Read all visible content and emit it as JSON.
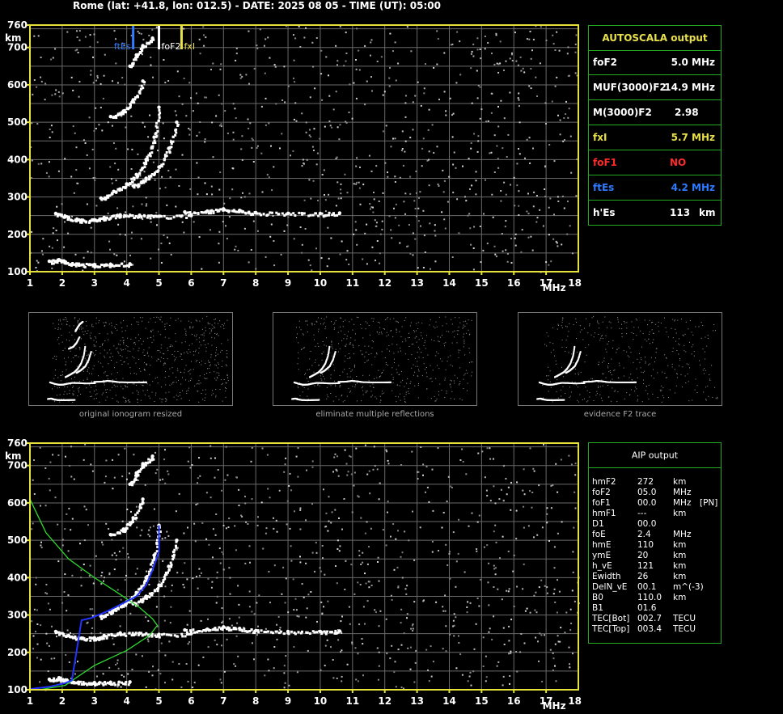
{
  "header": {
    "title": "Rome (lat: +41.8, lon: 012.5) - DATE: 2025 08 05 - TIME (UT): 05:00"
  },
  "colors": {
    "frame": "#e6e23a",
    "grid": "#6a6a6a",
    "table_border": "#1faa1f",
    "blue": "#2f7bff",
    "yellow": "#e8e04a",
    "red": "#ff2a2a",
    "green": "#2edc2e",
    "profile": "#2233ff"
  },
  "chart_data": [
    {
      "type": "scatter",
      "name": "top",
      "xlabel": "MHz",
      "ylabel": "km",
      "xlim": [
        1,
        18
      ],
      "ylim": [
        100,
        760
      ],
      "xticks": [
        "1",
        "2",
        "3",
        "4",
        "5",
        "6",
        "7",
        "8",
        "9",
        "10",
        "11",
        "12",
        "13",
        "14",
        "15",
        "16",
        "17",
        "18"
      ],
      "yticks": [
        "100",
        "200",
        "300",
        "400",
        "500",
        "600",
        "700",
        "760"
      ],
      "grid": true,
      "markers": [
        {
          "label": "ftEs",
          "x": 4.2,
          "color": "blue"
        },
        {
          "label": "foF2",
          "x": 5.0,
          "color": "white"
        },
        {
          "label": "fxI",
          "x": 5.7,
          "color": "yellow"
        }
      ],
      "traces": [
        {
          "name": "Es",
          "points": [
            [
              1.6,
              128
            ],
            [
              1.9,
              132
            ],
            [
              2.1,
              126
            ],
            [
              2.5,
              120
            ],
            [
              3.0,
              119
            ],
            [
              3.5,
              120
            ],
            [
              4.1,
              121
            ]
          ]
        },
        {
          "name": "F low",
          "points": [
            [
              1.8,
              256
            ],
            [
              2.2,
              245
            ],
            [
              2.6,
              238
            ],
            [
              3.0,
              239
            ],
            [
              3.3,
              245
            ],
            [
              3.8,
              252
            ],
            [
              4.4,
              251
            ],
            [
              5.0,
              248
            ],
            [
              6.0,
              250
            ]
          ]
        },
        {
          "name": "F spread",
          "points": [
            [
              5.8,
              260
            ],
            [
              6.5,
              262
            ],
            [
              7.0,
              268
            ],
            [
              7.5,
              264
            ],
            [
              8.0,
              258
            ],
            [
              9.0,
              256
            ],
            [
              10.0,
              256
            ],
            [
              10.6,
              257
            ]
          ]
        },
        {
          "name": "F2 o",
          "points": [
            [
              3.2,
              297
            ],
            [
              3.6,
              315
            ],
            [
              4.0,
              335
            ],
            [
              4.3,
              360
            ],
            [
              4.6,
              400
            ],
            [
              4.85,
              460
            ],
            [
              5.0,
              540
            ]
          ]
        },
        {
          "name": "F2 x",
          "points": [
            [
              4.2,
              330
            ],
            [
              4.6,
              350
            ],
            [
              5.0,
              380
            ],
            [
              5.3,
              430
            ],
            [
              5.55,
              500
            ]
          ]
        },
        {
          "name": "multi 1",
          "points": [
            [
              3.5,
              515
            ],
            [
              3.9,
              530
            ],
            [
              4.2,
              560
            ],
            [
              4.5,
              610
            ]
          ]
        },
        {
          "name": "multi 2",
          "points": [
            [
              4.1,
              650
            ],
            [
              4.3,
              680
            ],
            [
              4.5,
              705
            ],
            [
              4.8,
              725
            ]
          ]
        }
      ]
    },
    {
      "type": "scatter",
      "name": "bottom",
      "xlabel": "MHz",
      "ylabel": "km",
      "xlim": [
        1,
        18
      ],
      "ylim": [
        100,
        760
      ],
      "xticks": [
        "1",
        "2",
        "3",
        "4",
        "5",
        "6",
        "7",
        "8",
        "9",
        "10",
        "11",
        "12",
        "13",
        "14",
        "15",
        "16",
        "17",
        "18"
      ],
      "yticks": [
        "100",
        "200",
        "300",
        "400",
        "500",
        "600",
        "700",
        "760"
      ],
      "grid": true,
      "traces": [
        {
          "name": "Es",
          "points": [
            [
              1.6,
              128
            ],
            [
              1.9,
              132
            ],
            [
              2.1,
              126
            ],
            [
              2.5,
              120
            ],
            [
              3.0,
              119
            ],
            [
              3.5,
              120
            ],
            [
              4.1,
              121
            ]
          ]
        },
        {
          "name": "F low",
          "points": [
            [
              1.8,
              256
            ],
            [
              2.2,
              245
            ],
            [
              2.6,
              238
            ],
            [
              3.0,
              239
            ],
            [
              3.3,
              245
            ],
            [
              3.8,
              252
            ],
            [
              4.4,
              251
            ],
            [
              5.0,
              248
            ],
            [
              6.0,
              250
            ]
          ]
        },
        {
          "name": "F spread",
          "points": [
            [
              5.8,
              260
            ],
            [
              6.5,
              262
            ],
            [
              7.0,
              268
            ],
            [
              7.5,
              264
            ],
            [
              8.0,
              258
            ],
            [
              9.0,
              256
            ],
            [
              10.0,
              256
            ],
            [
              10.6,
              257
            ]
          ]
        },
        {
          "name": "F2 o",
          "points": [
            [
              3.2,
              297
            ],
            [
              3.6,
              315
            ],
            [
              4.0,
              335
            ],
            [
              4.3,
              360
            ],
            [
              4.6,
              400
            ],
            [
              4.85,
              460
            ],
            [
              5.0,
              540
            ]
          ]
        },
        {
          "name": "F2 x",
          "points": [
            [
              4.2,
              330
            ],
            [
              4.6,
              350
            ],
            [
              5.0,
              380
            ],
            [
              5.3,
              430
            ],
            [
              5.55,
              500
            ]
          ]
        },
        {
          "name": "multi 1",
          "points": [
            [
              3.5,
              515
            ],
            [
              3.9,
              530
            ],
            [
              4.2,
              560
            ],
            [
              4.5,
              610
            ]
          ]
        },
        {
          "name": "multi 2",
          "points": [
            [
              4.1,
              650
            ],
            [
              4.3,
              680
            ],
            [
              4.5,
              705
            ],
            [
              4.8,
              725
            ]
          ]
        }
      ],
      "profile_green": [
        [
          1.0,
          610
        ],
        [
          1.5,
          520
        ],
        [
          2.2,
          450
        ],
        [
          3.0,
          400
        ],
        [
          3.8,
          355
        ],
        [
          4.4,
          320
        ],
        [
          4.8,
          290
        ],
        [
          4.95,
          272
        ],
        [
          4.7,
          245
        ],
        [
          4.0,
          205
        ],
        [
          3.0,
          165
        ],
        [
          2.4,
          130
        ],
        [
          2.1,
          112
        ],
        [
          1.3,
          100
        ],
        [
          1.0,
          100
        ]
      ],
      "profile_blue": [
        [
          1.0,
          102
        ],
        [
          1.6,
          108
        ],
        [
          2.1,
          118
        ],
        [
          2.3,
          125
        ],
        [
          2.6,
          286
        ],
        [
          2.9,
          292
        ],
        [
          3.4,
          310
        ],
        [
          3.9,
          332
        ],
        [
          4.3,
          350
        ],
        [
          4.6,
          380
        ],
        [
          4.8,
          420
        ],
        [
          5.0,
          470
        ],
        [
          5.0,
          540
        ]
      ]
    }
  ],
  "autoscala": {
    "title": "AUTOSCALA output",
    "rows": [
      {
        "label": "foF2",
        "value": "5.0 MHz",
        "color": "white"
      },
      {
        "label": "MUF(3000)F2",
        "value": "14.9 MHz",
        "color": "white"
      },
      {
        "label": "M(3000)F2",
        "value": "2.98",
        "color": "white"
      },
      {
        "label": "fxI",
        "value": "5.7 MHz",
        "color": "yellow"
      },
      {
        "label": "foF1",
        "value": "NO",
        "color": "red"
      },
      {
        "label": "ftEs",
        "value": "4.2 MHz",
        "color": "blue"
      },
      {
        "label": "h'Es",
        "value": "113",
        "unit": "km",
        "color": "white"
      }
    ]
  },
  "aip": {
    "title": "AIP output",
    "rows": [
      {
        "label": "hmF2",
        "value": "272",
        "unit": "km"
      },
      {
        "label": "foF2",
        "value": "05.0",
        "unit": "MHz"
      },
      {
        "label": "foF1",
        "value": "00.0",
        "unit": "MHz",
        "extra": "[PN]"
      },
      {
        "label": "hmF1",
        "value": "---",
        "unit": "km"
      },
      {
        "label": "D1",
        "value": "00.0",
        "unit": ""
      },
      {
        "label": "foE",
        "value": "2.4",
        "unit": "MHz"
      },
      {
        "label": "hmE",
        "value": "110",
        "unit": "km"
      },
      {
        "label": "ymE",
        "value": "20",
        "unit": "km"
      },
      {
        "label": "h_vE",
        "value": "121",
        "unit": "km"
      },
      {
        "label": "Ewidth",
        "value": "26",
        "unit": "km"
      },
      {
        "label": "DelN_vE",
        "value": "00.1",
        "unit": "m^(-3)"
      },
      {
        "label": "B0",
        "value": "110.0",
        "unit": "km"
      },
      {
        "label": "B1",
        "value": "01.6",
        "unit": ""
      },
      {
        "label": "TEC[Bot]",
        "value": "002.7",
        "unit": "TECU"
      },
      {
        "label": "TEC[Top]",
        "value": "003.4",
        "unit": "TECU"
      }
    ]
  },
  "thumbnails": [
    {
      "caption": "original ionogram resized"
    },
    {
      "caption": "eliminate multiple reflections"
    },
    {
      "caption": "evidence F2 trace"
    }
  ]
}
